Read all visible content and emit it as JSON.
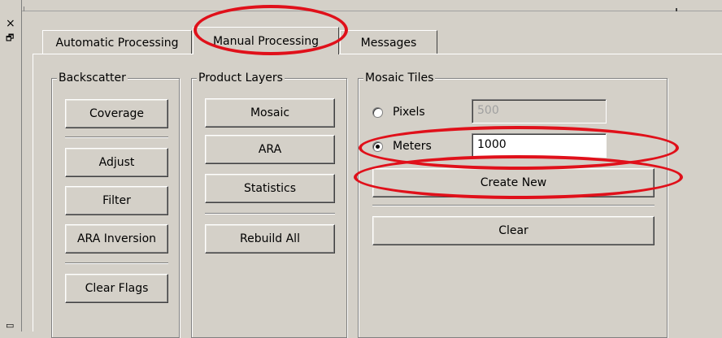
{
  "dock": {
    "close_glyph": "×",
    "restore_glyph": "🗗",
    "bottom_glyph": "▭"
  },
  "tabs": [
    {
      "label": "Automatic Processing",
      "active": false
    },
    {
      "label": "Manual Processing",
      "active": true
    },
    {
      "label": "Messages",
      "active": false
    }
  ],
  "backscatter": {
    "title": "Backscatter",
    "buttons": [
      "Coverage",
      "Adjust",
      "Filter",
      "ARA Inversion",
      "Clear Flags"
    ]
  },
  "product_layers": {
    "title": "Product Layers",
    "buttons": [
      "Mosaic",
      "ARA",
      "Statistics",
      "Rebuild All"
    ]
  },
  "mosaic_tiles": {
    "title": "Mosaic Tiles",
    "pixels_label": "Pixels",
    "pixels_value": "500",
    "meters_label": "Meters",
    "meters_value": "1000",
    "selected_unit": "Meters",
    "create_new_label": "Create New",
    "clear_label": "Clear"
  },
  "colors": {
    "window_bg": "#d4d0c8",
    "annotation_red": "#e0101a"
  }
}
